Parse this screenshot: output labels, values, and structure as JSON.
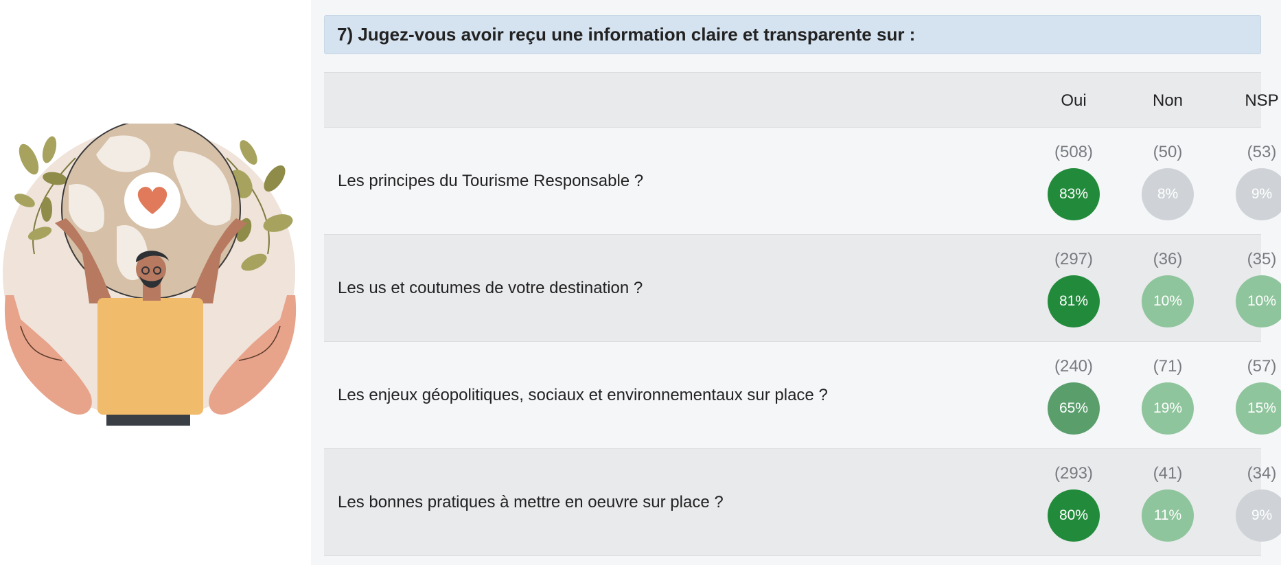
{
  "question": {
    "title": "7) Jugez-vous avoir reçu une information claire et transparente sur :"
  },
  "columns": [
    "Oui",
    "Non",
    "NSP"
  ],
  "colors": {
    "very_high": "#228b3b",
    "high": "#5a9e6c",
    "low": "#8fc59c",
    "very_low": "#cfd3d7"
  },
  "illustration": {
    "icon": "globe-heart-illustration"
  },
  "rows": [
    {
      "label": "Les principes du Tourisme Responsable ?",
      "cells": [
        {
          "count": "(508)",
          "pct": "83%",
          "level": "very_high"
        },
        {
          "count": "(50)",
          "pct": "8%",
          "level": "very_low"
        },
        {
          "count": "(53)",
          "pct": "9%",
          "level": "very_low"
        }
      ]
    },
    {
      "label": "Les us et coutumes de votre destination ?",
      "cells": [
        {
          "count": "(297)",
          "pct": "81%",
          "level": "very_high"
        },
        {
          "count": "(36)",
          "pct": "10%",
          "level": "low"
        },
        {
          "count": "(35)",
          "pct": "10%",
          "level": "low"
        }
      ]
    },
    {
      "label": "Les enjeux géopolitiques, sociaux et environnementaux sur place ?",
      "cells": [
        {
          "count": "(240)",
          "pct": "65%",
          "level": "high"
        },
        {
          "count": "(71)",
          "pct": "19%",
          "level": "low"
        },
        {
          "count": "(57)",
          "pct": "15%",
          "level": "low"
        }
      ]
    },
    {
      "label": "Les bonnes pratiques à mettre en oeuvre sur place ?",
      "cells": [
        {
          "count": "(293)",
          "pct": "80%",
          "level": "very_high"
        },
        {
          "count": "(41)",
          "pct": "11%",
          "level": "low"
        },
        {
          "count": "(34)",
          "pct": "9%",
          "level": "very_low"
        }
      ]
    }
  ]
}
